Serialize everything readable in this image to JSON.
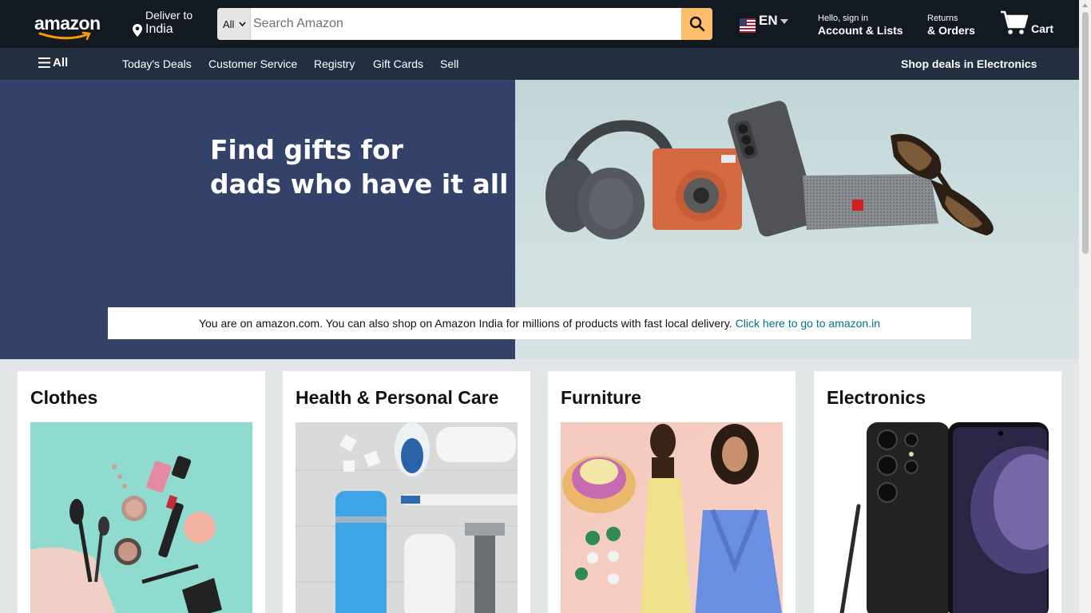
{
  "header": {
    "logo_text": "amazon",
    "deliver_to_label": "Deliver to",
    "deliver_to_location": "India",
    "search": {
      "category": "All",
      "placeholder": "Search Amazon"
    },
    "language": "EN",
    "account": {
      "greeting": "Hello, sign in",
      "label": "Account & Lists"
    },
    "returns": {
      "line1": "Returns",
      "line2": "& Orders"
    },
    "cart_label": "Cart"
  },
  "subnav": {
    "all_label": "All",
    "links": [
      "Today's Deals",
      "Customer Service",
      "Registry",
      "Gift Cards",
      "Sell"
    ],
    "promo": "Shop deals in Electronics"
  },
  "hero": {
    "title_line1": "Find gifts for",
    "title_line2": "dads who have it all",
    "notice_text": "You are on amazon.com. You can also shop on Amazon India for millions of products with fast local delivery.",
    "notice_link": "Click here to go to amazon.in"
  },
  "cards": [
    {
      "title": "Clothes"
    },
    {
      "title": "Health & Personal Care"
    },
    {
      "title": "Furniture"
    },
    {
      "title": "Electronics"
    }
  ],
  "colors": {
    "nav_bg": "#131921",
    "subnav_bg": "#232f3e",
    "search_button": "#febd69",
    "hero_left_bg": "#34426a",
    "link": "#007185",
    "page_bg": "#e3e6e6"
  }
}
